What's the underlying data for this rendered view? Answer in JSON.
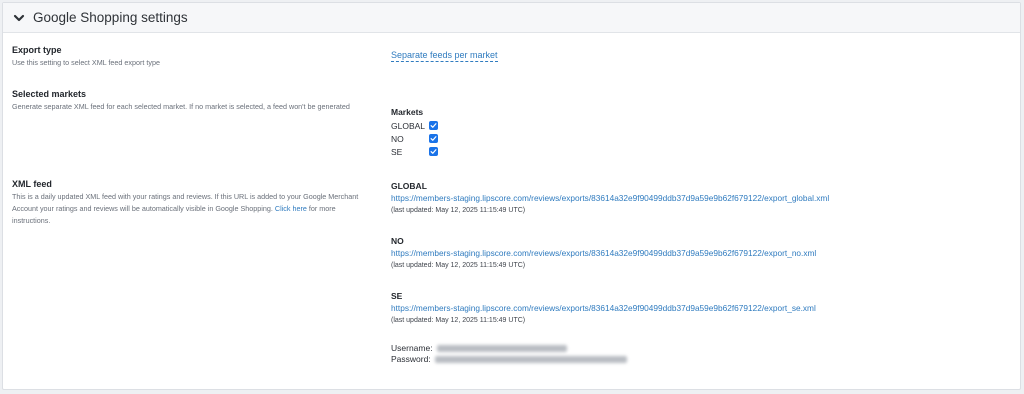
{
  "header": {
    "title": "Google Shopping settings",
    "toggle_icon": "chevron-down-icon"
  },
  "export_type": {
    "title": "Export type",
    "description": "Use this setting to select XML feed export type",
    "value": "Separate feeds per market"
  },
  "selected_markets": {
    "title": "Selected markets",
    "description": "Generate separate XML feed for each selected market. If no market is selected, a feed won't be generated",
    "markets_heading": "Markets",
    "markets": [
      {
        "label": "GLOBAL",
        "checked": true
      },
      {
        "label": "NO",
        "checked": true
      },
      {
        "label": "SE",
        "checked": true
      }
    ]
  },
  "xml_feed": {
    "title": "XML feed",
    "description": "This is a daily updated XML feed with your ratings and reviews. If this URL is added to your Google Merchant Account your ratings and reviews will be automatically visible in Google Shopping.",
    "link_text": "Click here",
    "link_suffix": "for more instructions.",
    "feeds": [
      {
        "name": "GLOBAL",
        "url": "https://members-staging.lipscore.com/reviews/exports/83614a32e9f90499ddb37d9a59e9b62f679122/export_global.xml",
        "updated": "(last updated: May 12, 2025 11:15:49 UTC)"
      },
      {
        "name": "NO",
        "url": "https://members-staging.lipscore.com/reviews/exports/83614a32e9f90499ddb37d9a59e9b62f679122/export_no.xml",
        "updated": "(last updated: May 12, 2025 11:15:49 UTC)"
      },
      {
        "name": "SE",
        "url": "https://members-staging.lipscore.com/reviews/exports/83614a32e9f90499ddb37d9a59e9b62f679122/export_se.xml",
        "updated": "(last updated: May 12, 2025 11:15:49 UTC)"
      }
    ],
    "username_label": "Username:",
    "password_label": "Password:"
  },
  "colors": {
    "link": "#2f7bbf",
    "checkbox": "#1a73e8",
    "header_bg": "#f6f7f9"
  }
}
